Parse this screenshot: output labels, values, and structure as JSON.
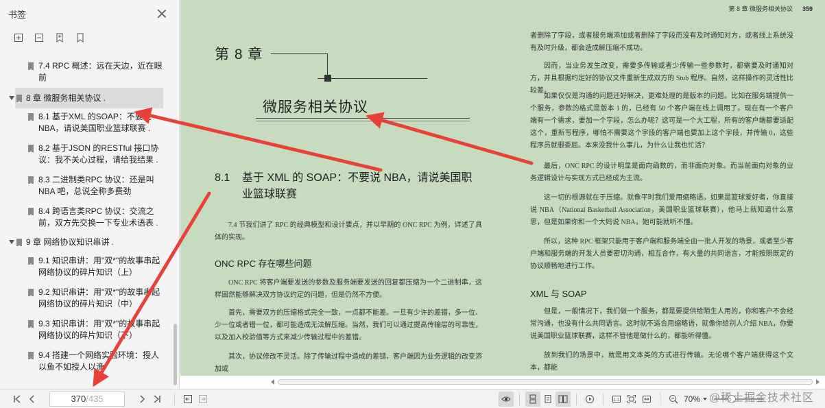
{
  "sidebar": {
    "title": "书签",
    "tools": [
      "expand-all-icon",
      "collapse-all-icon",
      "add-bookmark-icon",
      "bookmark-icon"
    ],
    "items": [
      {
        "level": 2,
        "text": "7.4 RPC 概述：远在天边，近在眼前"
      },
      {
        "level": 1,
        "text": "8 章 微服务相关协议 .",
        "active": true
      },
      {
        "level": 2,
        "text": "8.1 基于XML 的SOAP：不要说NBA，请说美国职业篮球联赛 ."
      },
      {
        "level": 2,
        "text": "8.2 基于JSON 的RESTful 接口协议：我不关心过程，请给我结果 ."
      },
      {
        "level": 2,
        "text": "8.3 二进制类RPC 协议：还是叫NBA 吧，总说全称多费劲"
      },
      {
        "level": 2,
        "text": "8.4 跨语言类RPC 协议：交流之前，双方先交换一下专业术语表 ."
      },
      {
        "level": 1,
        "text": "9 章 网络协议知识串讲 ."
      },
      {
        "level": 2,
        "text": "9.1 知识串讲：用\"双*\"的故事串起网络协议的碎片知识（上）"
      },
      {
        "level": 2,
        "text": "9.2 知识串讲：用\"双*\"的故事串起网络协议的碎片知识（中）"
      },
      {
        "level": 2,
        "text": "9.3 知识串讲：用\"双*\"的故事串起网络协议的碎片知识（下）"
      },
      {
        "level": 2,
        "text": "9.4 搭建一个网络实验环境：授人以鱼不如授人以渔"
      }
    ]
  },
  "left_page": {
    "chapter_label": "第 8 章",
    "chapter_title": "微服务相关协议",
    "section_num": "8.1",
    "section_title": "基于 XML 的 SOAP：不要说 NBA，请说美国职业篮球联赛",
    "intro": "7.4 节我们讲了 RPC 的经典模型和设计要点，并以早期的 ONC RPC 为例，详述了具体的实现。",
    "sub_head": "ONC RPC 存在哪些问题",
    "p1": "ONC RPC 将客户端要发送的参数及服务端要发送的回复都压缩为一个二进制串，这样固然能够解决双方协议约定的问题，但是仍然不方便。",
    "p2": "首先，需要双方的压缩格式完全一致，一点都不能差。一旦有少许的差错，多一位、少一位或者错一位，都可能造成无法解压缩。当然，我们可以通过提高传输层的可靠性，以及加入校验值等方式来减少传输过程中的差错。",
    "p3": "其次，协议修改不灵活。除了传输过程中造成的差错，客户端因为业务逻辑的改变添加或"
  },
  "right_page": {
    "running_head": "第 8 章  微服务相关协议",
    "page_number": "359",
    "p0": "者删除了字段，或者服务端添加或者删除了字段而没有及时通知对方，或者线上系统没有及时升级，都会造成解压缩不成功。",
    "p1": "因而，当业务发生改变，需要多传输或者少传输一些参数时，都需要及时通知对方，并且根据约定好的协议文件重新生成双方的 Stub 程序。自然，这样操作的灵活性比较差。",
    "p2": "如果仅仅是沟通的问题还好解决，更难处理的是版本的问题。比如在服务端提供一个服务，参数的格式是版本 1 的，已经有 50 个客户端在线上调用了。现在有一个客户端有一个需求，要加一个字段，怎么办呢？这可是一个大工程，所有的客户端都要适配这个，重新写程序，哪怕不需要这个字段的客户端也要加上这个字段，并传输 0，这些程序员就很委屈。本来没我什么事儿，为什么让我也忙活？",
    "p3": "最后，ONC RPC 的设计明显是面向函数的，而非面向对象。而当前面向对象的业务逻辑设计与实现方式已经成为主流。",
    "p4": "这一切的根源就在于压缩。就像平时我们爱用缩略语。如果是篮球爱好者，你直接说 NBA（National Basketball Association，美国职业篮球联赛），他马上就知道什么意思，但是如果你和一个大妈说 NBA，她可能就听不懂。",
    "p5": "所以，这种 RPC 框架只能用于客户端和服务端全由一批人开发的场景，或者至少客户端和服务端的开发人员要密切沟通，相互合作，有大量的共同语言，才能按照既定的协议顺畅地进行工作。",
    "sub_head": "XML 与 SOAP",
    "p6": "但是，一般情况下，我们做一个服务，都是要提供给陌生人用的，你和客户不会经常沟通，也没有什么共同语言。这时就不适合用缩略语，就像你给别人介绍 NBA，你要说美国职业篮球联赛，这样不管他是做什么的，都能听得懂。",
    "p7": "放到我们的场景中，就是用文本类的方式进行传输。无论哪个客户端获得这个文本，都能"
  },
  "bottombar": {
    "current_page": "370",
    "separator": "/",
    "total_pages": "435",
    "zoom": "70%"
  },
  "watermark": "@稀土掘金技术社区",
  "colors": {
    "page_bg": "#c7dcbe",
    "sidebar_bg": "#f4f4f4",
    "arrow": "#e8413a"
  }
}
